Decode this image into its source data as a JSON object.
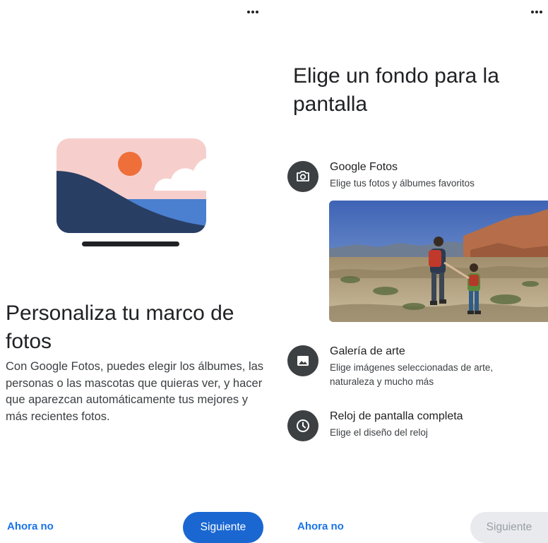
{
  "left": {
    "title": "Personaliza tu marco de fotos",
    "body": "Con Google Fotos, puedes elegir los álbumes, las personas o las mascotas que quieras ver, y hacer que aparezcan automáticamente tus mejores y más recientes fotos.",
    "secondary_label": "Ahora no",
    "primary_label": "Siguiente",
    "more_icon": "more-horiz-icon",
    "illustration_colors": {
      "sky": "#f6cfcc",
      "sun": "#ee6f3a",
      "cloud": "#ffffff",
      "sea": "#4b7fd0",
      "hill": "#283e63",
      "base": "#202124"
    }
  },
  "right": {
    "title": "Elige un fondo para la pantalla",
    "options": [
      {
        "icon": "camera-icon",
        "title": "Google Fotos",
        "subtitle": "Elige tus fotos y álbumes favoritos"
      },
      {
        "icon": "image-icon",
        "title": "Galería de arte",
        "subtitle": "Elige imágenes seleccionadas de arte, naturaleza y mucho más"
      },
      {
        "icon": "clock-icon",
        "title": "Reloj de pantalla completa",
        "subtitle": "Elige el diseño del reloj"
      }
    ],
    "secondary_label": "Ahora no",
    "primary_label": "Siguiente",
    "more_icon": "more-horiz-icon"
  },
  "colors": {
    "accent": "#1a67d2",
    "link": "#1a73e8",
    "icon_bg": "#3c4043",
    "disabled_bg": "#e8eaed",
    "disabled_text": "#9aa0a6"
  }
}
